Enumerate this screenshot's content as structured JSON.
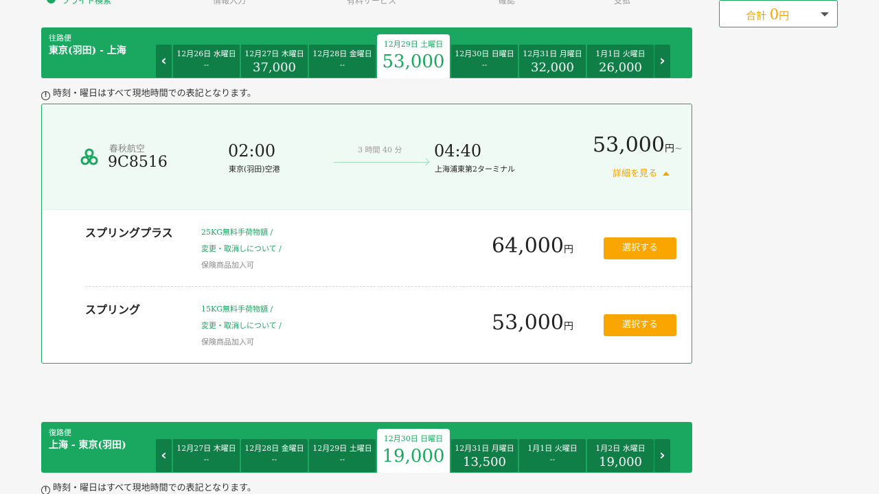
{
  "steps": [
    "フライト検索",
    "情報入力",
    "有料サービス",
    "確認",
    "支払"
  ],
  "total": {
    "label": "合計",
    "amount": "0",
    "unit": "円"
  },
  "outbound": {
    "kind": "往路便",
    "route": "東京(羽田) - 上海",
    "dates": [
      {
        "date": "12月26日 水曜日",
        "price": "--"
      },
      {
        "date": "12月27日 木曜日",
        "price": "37,000"
      },
      {
        "date": "12月28日 金曜日",
        "price": "--"
      },
      {
        "date": "12月29日 土曜日",
        "price": "53,000"
      },
      {
        "date": "12月30日 日曜日",
        "price": "--"
      },
      {
        "date": "12月31日 月曜日",
        "price": "32,000"
      },
      {
        "date": "1月1日 火曜日",
        "price": "26,000"
      }
    ],
    "selected_index": 3
  },
  "notice": "時刻・曜日はすべて現地時間での表記となります。",
  "flight": {
    "airline": "春秋航空",
    "number": "9C8516",
    "dep_time": "02:00",
    "dep_airport": "東京(羽田)空港",
    "duration": "3 時間 40 分",
    "arr_time": "04:40",
    "arr_airport": "上海浦東第2ターミナル",
    "price": "53,000",
    "price_unit": "円",
    "price_suffix": "~",
    "details_label": "詳細を見る"
  },
  "fares": [
    {
      "name": "スプリングプラス",
      "baggage": "25KG無料手荷物額 /",
      "change": "変更・取消しについて /",
      "insurance": "保険商品加入可",
      "price": "64,000",
      "unit": "円",
      "button": "選択する"
    },
    {
      "name": "スプリング",
      "baggage": "15KG無料手荷物額 /",
      "change": "変更・取消しについて /",
      "insurance": "保険商品加入可",
      "price": "53,000",
      "unit": "円",
      "button": "選択する"
    }
  ],
  "return": {
    "kind": "復路便",
    "route": "上海 - 東京(羽田)",
    "dates": [
      {
        "date": "12月27日 木曜日",
        "price": "--"
      },
      {
        "date": "12月28日 金曜日",
        "price": "--"
      },
      {
        "date": "12月29日 土曜日",
        "price": "--"
      },
      {
        "date": "12月30日 日曜日",
        "price": "19,000"
      },
      {
        "date": "12月31日 月曜日",
        "price": "13,500"
      },
      {
        "date": "1月1日 火曜日",
        "price": "--"
      },
      {
        "date": "1月2日 水曜日",
        "price": "19,000"
      }
    ],
    "selected_index": 3
  },
  "icons": {
    "prev": "chevron-left-icon",
    "next": "chevron-right-icon",
    "info": "info-circle-icon",
    "caret": "caret-down-icon",
    "airline": "spring-airlines-logo-icon"
  },
  "colors": {
    "brand_green": "#1aa861",
    "dark_green": "#0f7e47",
    "accent_orange": "#f9a600"
  }
}
